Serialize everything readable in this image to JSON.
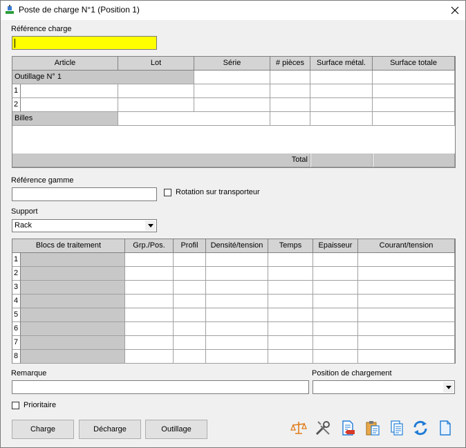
{
  "window": {
    "title": "Poste de charge N°1 (Position 1)"
  },
  "reference_charge": {
    "label": "Référence charge",
    "value": ""
  },
  "charge_table": {
    "headers": [
      "Article",
      "Lot",
      "Série",
      "# pièces",
      "Surface métal.",
      "Surface totale"
    ],
    "outillage_label": "Outillage N° 1",
    "rows": [
      "1",
      "2"
    ],
    "billes_label": "Billes",
    "total_label": "Total"
  },
  "reference_gamme": {
    "label": "Référence gamme",
    "value": ""
  },
  "rotation": {
    "label": "Rotation sur transporteur",
    "checked": false
  },
  "support": {
    "label": "Support",
    "value": "Rack"
  },
  "blocs_table": {
    "headers": [
      "Blocs de traitement",
      "Grp./Pos.",
      "Profil",
      "Densité/tension",
      "Temps",
      "Epaisseur",
      "Courant/tension"
    ],
    "rows": [
      "1",
      "2",
      "3",
      "4",
      "5",
      "6",
      "7",
      "8"
    ]
  },
  "remarque": {
    "label": "Remarque",
    "value": ""
  },
  "position_chargement": {
    "label": "Position de chargement",
    "value": ""
  },
  "prioritaire": {
    "label": "Prioritaire",
    "checked": false
  },
  "buttons": {
    "charge": "Charge",
    "decharge": "Décharge",
    "outillage": "Outillage"
  },
  "icons": [
    "balance-icon",
    "tools-icon",
    "document-delete-icon",
    "paste-icon",
    "copy-icon",
    "refresh-icon",
    "new-document-icon"
  ],
  "colors": {
    "highlight": "#ffff00",
    "accent": "#1e7bd6",
    "orange": "#e07b1a"
  }
}
